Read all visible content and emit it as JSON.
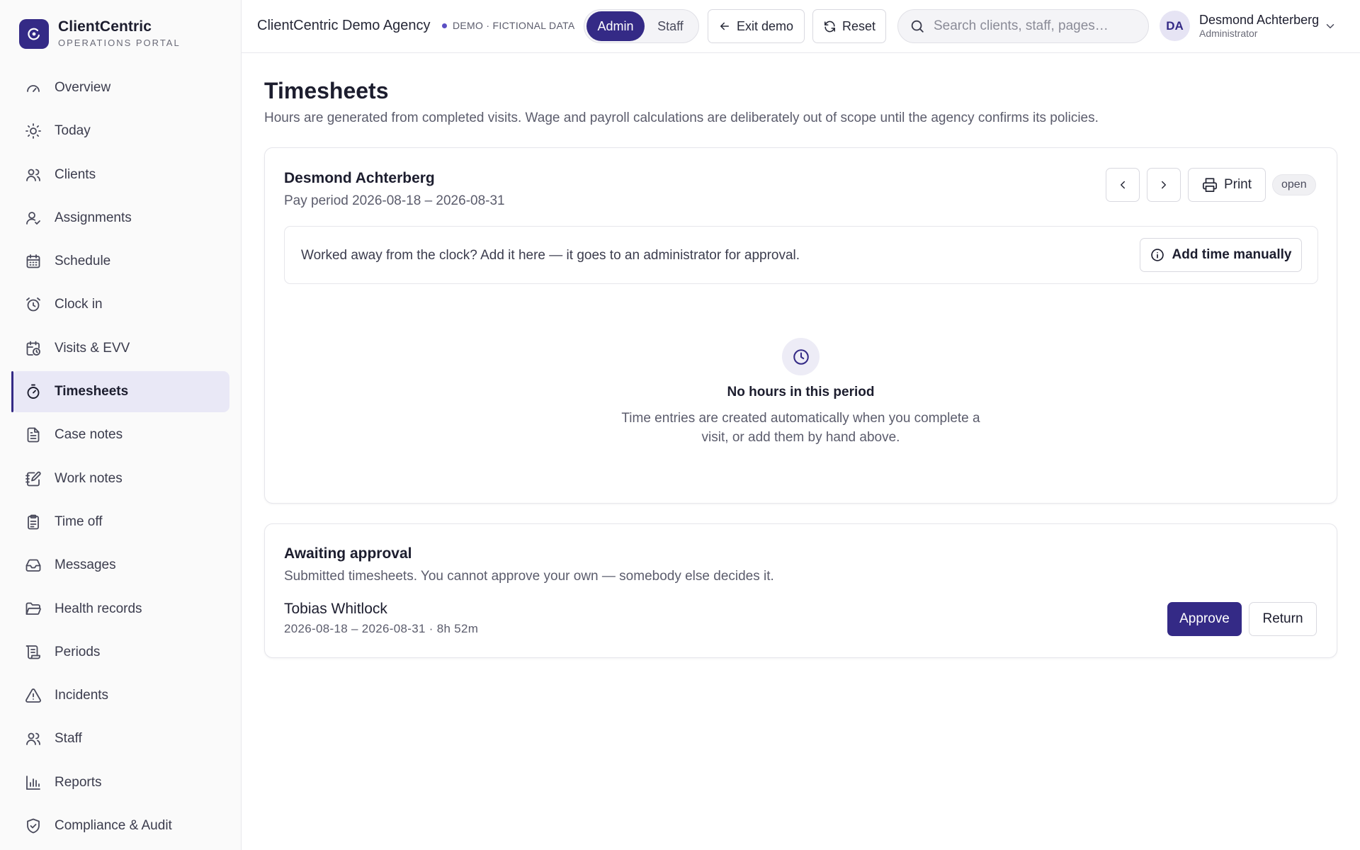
{
  "brand": {
    "name": "ClientCentric",
    "subtitle": "OPERATIONS PORTAL",
    "logo_icon": "clientcentric-logo"
  },
  "sidebar": {
    "active": "Timesheets",
    "items": [
      {
        "label": "Overview",
        "icon": "gauge-icon"
      },
      {
        "label": "Today",
        "icon": "sun-icon"
      },
      {
        "label": "Clients",
        "icon": "users-icon"
      },
      {
        "label": "Assignments",
        "icon": "user-check-icon"
      },
      {
        "label": "Schedule",
        "icon": "calendar-icon"
      },
      {
        "label": "Clock in",
        "icon": "alarm-clock-icon"
      },
      {
        "label": "Visits & EVV",
        "icon": "calendar-clock-icon"
      },
      {
        "label": "Timesheets",
        "icon": "timer-icon"
      },
      {
        "label": "Case notes",
        "icon": "file-text-icon"
      },
      {
        "label": "Work notes",
        "icon": "notebook-pen-icon"
      },
      {
        "label": "Time off",
        "icon": "clipboard-icon"
      },
      {
        "label": "Messages",
        "icon": "inbox-icon"
      },
      {
        "label": "Health records",
        "icon": "folder-open-icon"
      },
      {
        "label": "Periods",
        "icon": "scroll-icon"
      },
      {
        "label": "Incidents",
        "icon": "alert-triangle-icon"
      },
      {
        "label": "Staff",
        "icon": "users-icon"
      },
      {
        "label": "Reports",
        "icon": "bar-chart-icon"
      },
      {
        "label": "Compliance & Audit",
        "icon": "shield-check-icon"
      }
    ]
  },
  "topbar": {
    "agency": "ClientCentric Demo Agency",
    "demo_badge": "DEMO · FICTIONAL DATA",
    "roles": {
      "admin": "Admin",
      "staff": "Staff",
      "selected": "Admin"
    },
    "exit_label": "Exit demo",
    "reset_label": "Reset",
    "search_placeholder": "Search clients, staff, pages…",
    "user": {
      "initials": "DA",
      "name": "Desmond Achterberg",
      "role": "Administrator"
    }
  },
  "page": {
    "title": "Timesheets",
    "description": "Hours are generated from completed visits. Wage and payroll calculations are deliberately out of scope until the agency confirms its policies."
  },
  "timesheet": {
    "employee": "Desmond Achterberg",
    "pay_period": "Pay period 2026-08-18 – 2026-08-31",
    "print_label": "Print",
    "status": "open",
    "manual_prompt": "Worked away from the clock? Add it here — it goes to an administrator for approval.",
    "add_manual_label": "Add time manually",
    "empty_title": "No hours in this period",
    "empty_desc": "Time entries are created automatically when you complete a visit, or add them by hand above."
  },
  "approval": {
    "title": "Awaiting approval",
    "description": "Submitted timesheets. You cannot approve your own — somebody else decides it.",
    "entries": [
      {
        "name": "Tobias Whitlock",
        "meta": "2026-08-18 – 2026-08-31 · 8h 52m"
      }
    ],
    "approve_label": "Approve",
    "return_label": "Return"
  },
  "colors": {
    "accent": "#342a86",
    "active_nav_bg": "#e9e8f6",
    "sidebar_bg": "#fafafa"
  }
}
